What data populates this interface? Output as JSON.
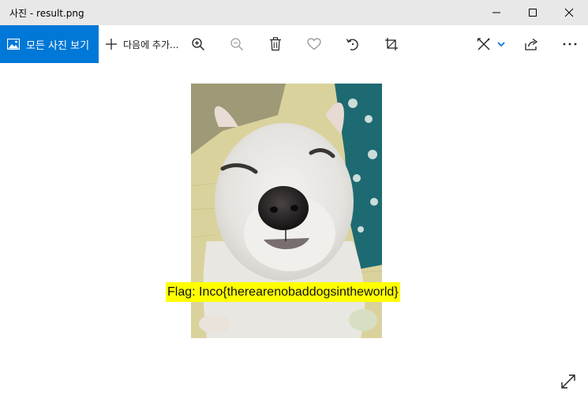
{
  "window": {
    "title": "사진 - result.png"
  },
  "toolbar": {
    "all_photos_label": "모든 사진 보기",
    "add_to_label": "다음에 추가...",
    "icons": [
      "photo-icon",
      "plus-icon",
      "zoom-in-icon",
      "zoom-out-icon",
      "delete-icon",
      "heart-icon",
      "rotate-icon",
      "crop-icon",
      "edit-draw-icon",
      "chevron-down-icon",
      "share-icon",
      "more-icon"
    ]
  },
  "image": {
    "overlay_text": "Flag: Inco{therearenobaddogsintheworld}",
    "overlay_bg": "#ffff00"
  },
  "colors": {
    "accent": "#0078d7",
    "titlebar": "#e8e8e8"
  }
}
